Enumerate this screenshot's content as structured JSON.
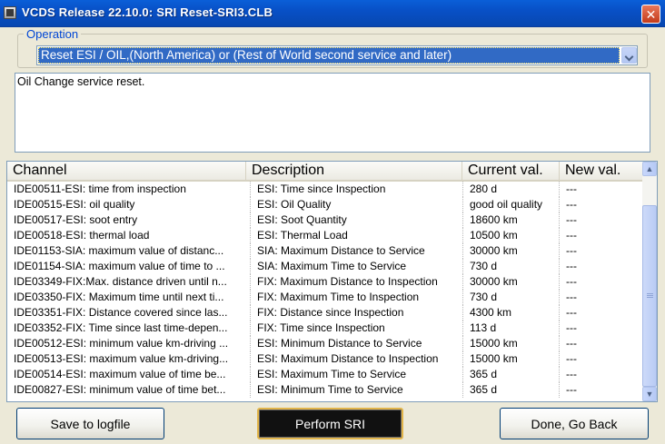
{
  "window": {
    "title": "VCDS Release 22.10.0:  SRI Reset-SRI3.CLB",
    "close_label": "✕"
  },
  "operation": {
    "label": "Operation",
    "selected": "Reset ESI / OIL,(North America) or (Rest of World second service and later)"
  },
  "description": "Oil Change service reset.",
  "table": {
    "headers": {
      "channel": "Channel",
      "description": "Description",
      "current": "Current val.",
      "new": "New val."
    },
    "rows": [
      {
        "channel": "IDE00511-ESI: time from inspection",
        "description": "ESI: Time since Inspection",
        "current": "280 d",
        "new": "---"
      },
      {
        "channel": "IDE00515-ESI: oil quality",
        "description": "ESI: Oil Quality",
        "current": "good oil quality",
        "new": "---"
      },
      {
        "channel": "IDE00517-ESI: soot entry",
        "description": "ESI: Soot Quantity",
        "current": "18600 km",
        "new": "---"
      },
      {
        "channel": "IDE00518-ESI: thermal load",
        "description": "ESI: Thermal Load",
        "current": "10500 km",
        "new": "---"
      },
      {
        "channel": "IDE01153-SIA: maximum value of distanc...",
        "description": "SIA: Maximum Distance to Service",
        "current": "30000 km",
        "new": "---"
      },
      {
        "channel": "IDE01154-SIA: maximum value of time to ...",
        "description": "SIA: Maximum Time to Service",
        "current": "730 d",
        "new": "---"
      },
      {
        "channel": "IDE03349-FIX:Max. distance driven until n...",
        "description": "FIX: Maximum Distance to Inspection",
        "current": "30000 km",
        "new": "---"
      },
      {
        "channel": "IDE03350-FIX: Maximum time until next ti...",
        "description": "FIX: Maximum Time to Inspection",
        "current": "730 d",
        "new": "---"
      },
      {
        "channel": "IDE03351-FIX: Distance covered since las...",
        "description": "FIX: Distance since Inspection",
        "current": "4300 km",
        "new": "---"
      },
      {
        "channel": "IDE03352-FIX: Time since last time-depen...",
        "description": "FIX: Time since Inspection",
        "current": "113 d",
        "new": "---"
      },
      {
        "channel": "IDE00512-ESI: minimum value km-driving ...",
        "description": "ESI: Minimum Distance to Service",
        "current": "15000 km",
        "new": "---"
      },
      {
        "channel": "IDE00513-ESI: maximum value km-driving...",
        "description": "ESI: Maximum Distance to Inspection",
        "current": "15000 km",
        "new": "---"
      },
      {
        "channel": "IDE00514-ESI: maximum value of time be...",
        "description": "ESI: Maximum Time to Service",
        "current": "365 d",
        "new": "---"
      },
      {
        "channel": "IDE00827-ESI: minimum value of time bet...",
        "description": "ESI: Minimum Time to Service",
        "current": "365 d",
        "new": "---"
      }
    ]
  },
  "buttons": {
    "save": "Save to logfile",
    "perform": "Perform SRI",
    "done": "Done, Go Back"
  },
  "scrollbar": {
    "up_glyph": "▲",
    "down_glyph": "▼"
  }
}
